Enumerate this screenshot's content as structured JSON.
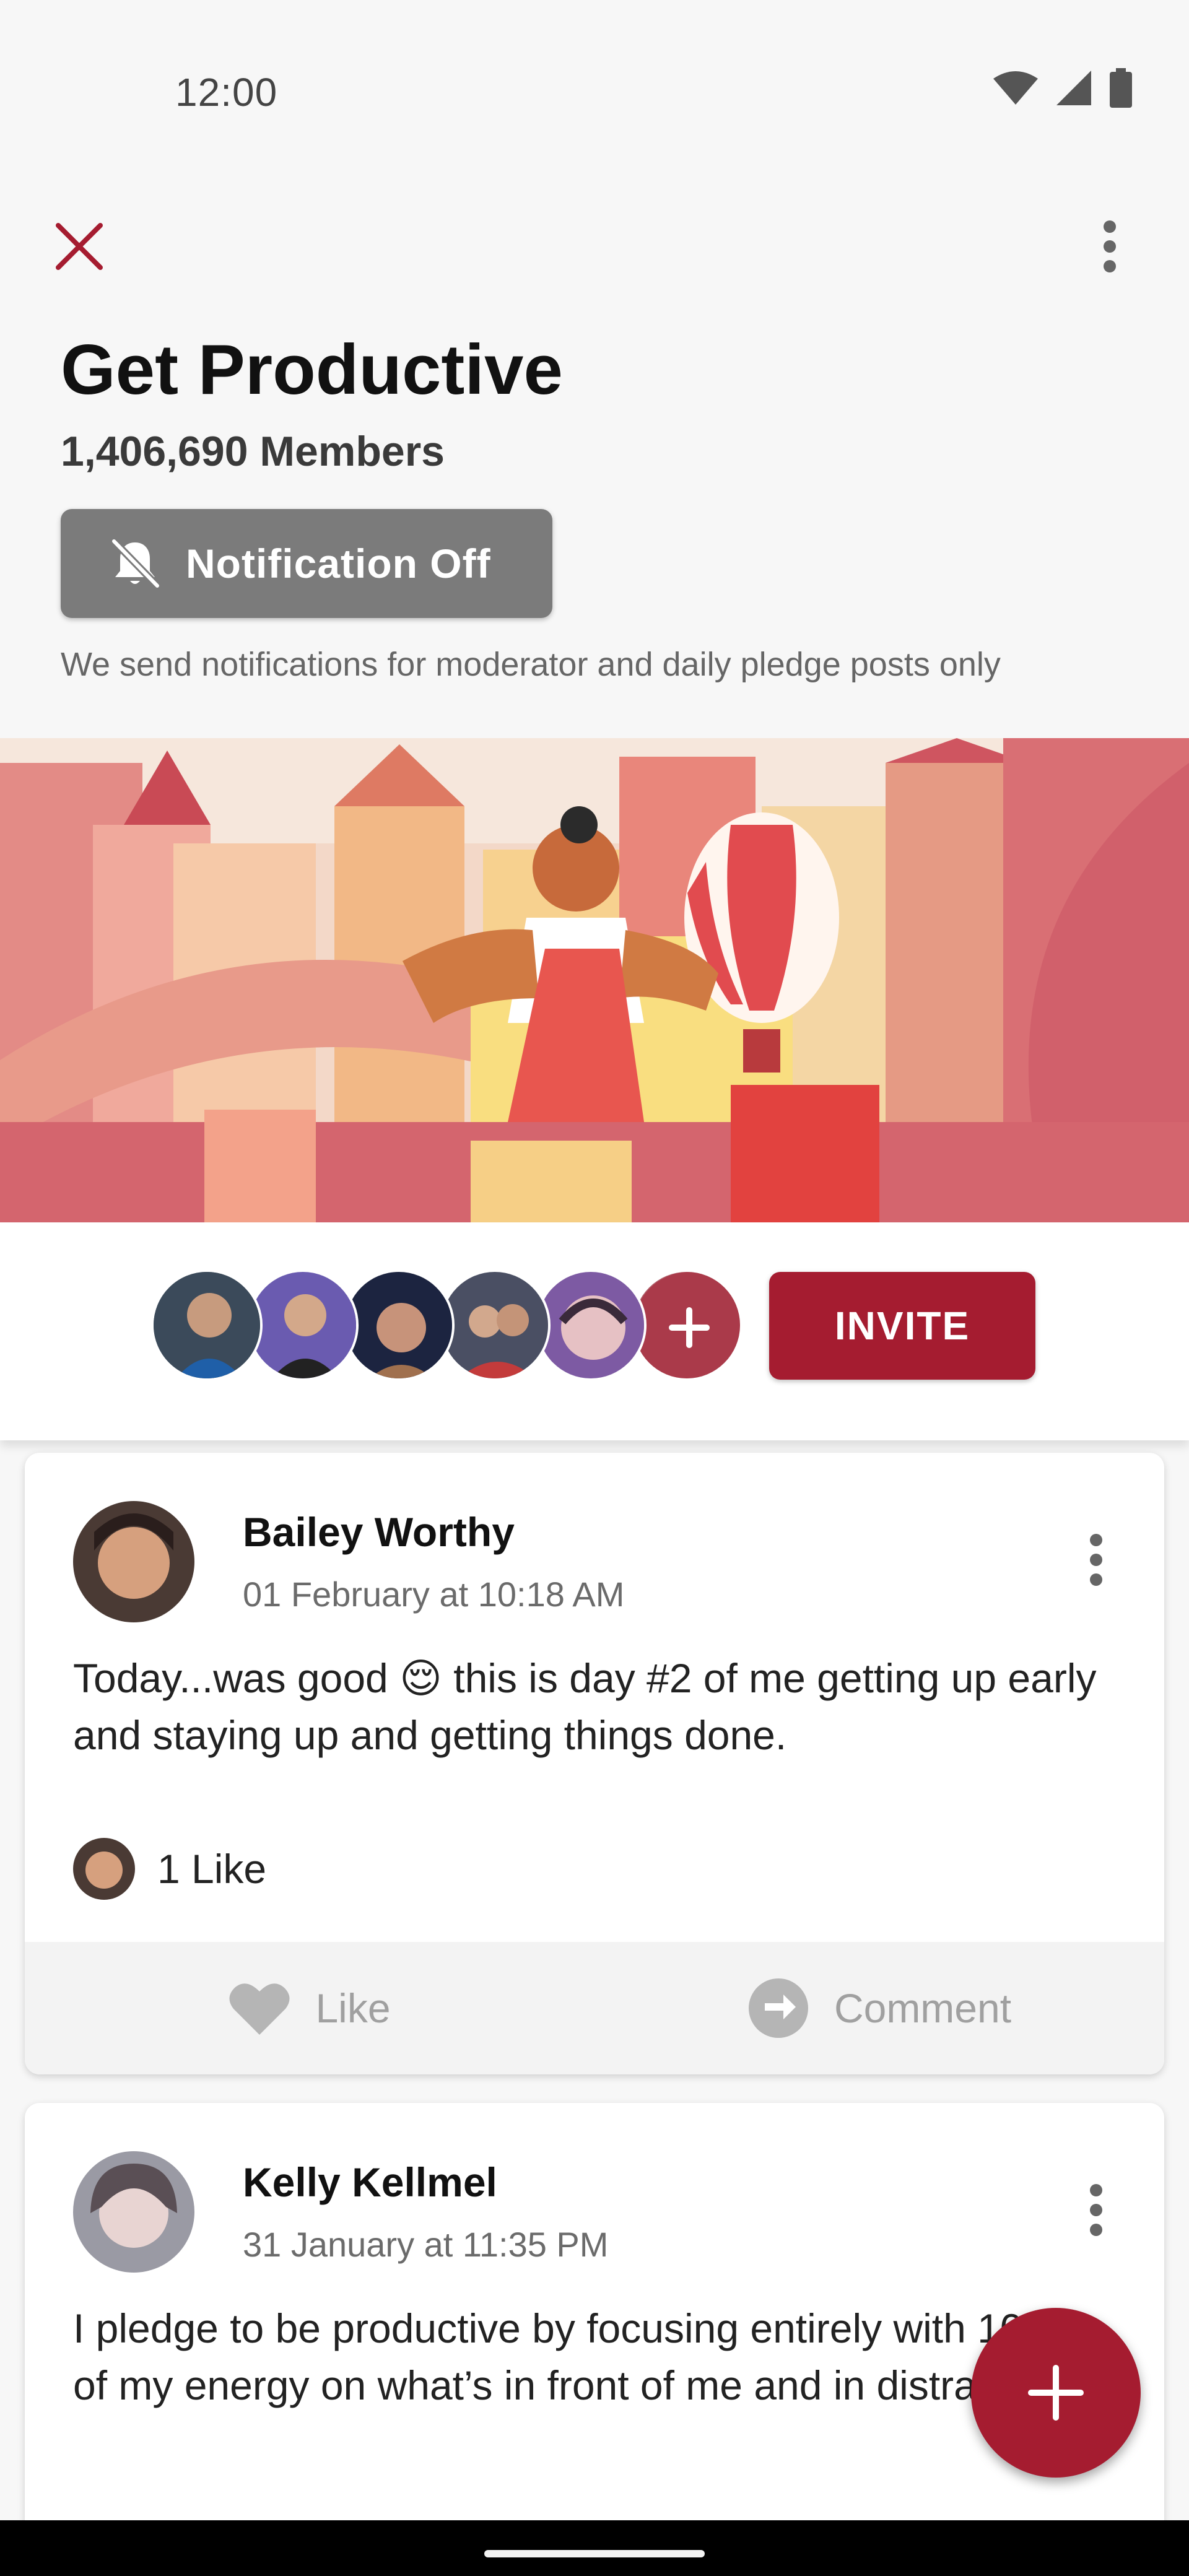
{
  "status_bar": {
    "time": "12:00",
    "icons": [
      "wifi-icon",
      "signal-icon",
      "battery-icon"
    ]
  },
  "header": {
    "close_icon": "close-icon",
    "more_icon": "more-vert-icon"
  },
  "group": {
    "title": "Get Productive",
    "members": "1,406,690 Members",
    "notification_button": "Notification Off",
    "notification_note": "We send notifications for moderator and daily pledge posts only"
  },
  "members_row": {
    "invite_label": "INVITE",
    "avatar_count": 6
  },
  "posts": [
    {
      "author": "Bailey Worthy",
      "date": "01 February at 10:18 AM",
      "text": "Today...was good 😌 this is day #2 of me getting up early and staying up and getting things done.",
      "likes": "1 Like",
      "like_label": "Like",
      "comment_label": "Comment"
    },
    {
      "author": "Kelly Kellmel",
      "date": "31 January at 11:35 PM",
      "text": "I pledge to be productive by focusing entirely with 100% of my energy on what’s in front of me and in distractions"
    }
  ],
  "colors": {
    "accent": "#a51c30",
    "notification_button": "#7b7b7b",
    "background": "#f7f7f7"
  }
}
